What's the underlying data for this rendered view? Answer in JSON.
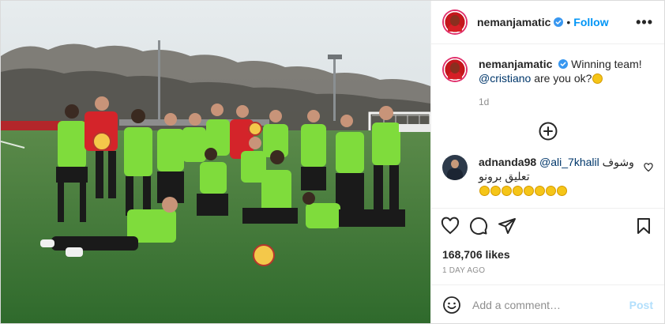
{
  "post": {
    "username": "nemanjamatic",
    "follow_label": "Follow",
    "more_label": "•••",
    "separator": "•"
  },
  "caption": {
    "username": "nemanjamatic",
    "text_before": "Winning team!",
    "mention": "@cristiano",
    "text_after": "are you ok?",
    "time": "1d"
  },
  "comments": [
    {
      "username": "adnanda98",
      "mention": "@ali_7khalil",
      "text": "وشوف تعليق برونو"
    }
  ],
  "actions": {
    "likes": "168,706 likes",
    "posted_ago": "1 DAY AGO"
  },
  "add_comment": {
    "placeholder": "Add a comment…",
    "post_label": "Post"
  },
  "icons": {
    "more": "more-options-icon",
    "verified": "verified-badge-icon",
    "load_more": "plus-circle-icon",
    "like": "heart-icon",
    "comment": "comment-bubble-icon",
    "share": "paper-plane-icon",
    "save": "bookmark-icon",
    "emoji": "smiley-icon"
  },
  "colors": {
    "accent": "#0095f6",
    "verified": "#3897f0",
    "post_disabled": "#b2dffc",
    "bib": "#7fdc3c",
    "grass": "#3f7a36"
  }
}
